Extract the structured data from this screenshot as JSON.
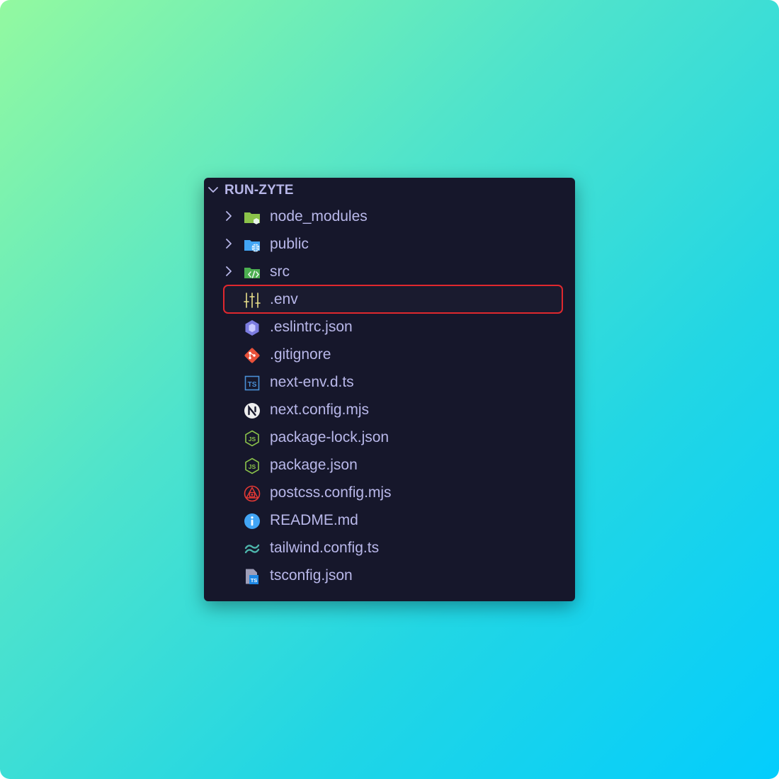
{
  "explorer": {
    "project_name": "RUN-ZYTE",
    "items": [
      {
        "label": "node_modules",
        "type": "folder",
        "icon": "folder-node-icon"
      },
      {
        "label": "public",
        "type": "folder",
        "icon": "folder-public-icon"
      },
      {
        "label": "src",
        "type": "folder",
        "icon": "folder-src-icon"
      },
      {
        "label": ".env",
        "type": "file",
        "icon": "env-settings-icon",
        "highlighted": true
      },
      {
        "label": ".eslintrc.json",
        "type": "file",
        "icon": "eslint-icon"
      },
      {
        "label": ".gitignore",
        "type": "file",
        "icon": "git-icon"
      },
      {
        "label": "next-env.d.ts",
        "type": "file",
        "icon": "typescript-def-icon"
      },
      {
        "label": "next.config.mjs",
        "type": "file",
        "icon": "nextjs-icon"
      },
      {
        "label": "package-lock.json",
        "type": "file",
        "icon": "nodejs-icon"
      },
      {
        "label": "package.json",
        "type": "file",
        "icon": "nodejs-icon"
      },
      {
        "label": "postcss.config.mjs",
        "type": "file",
        "icon": "postcss-icon"
      },
      {
        "label": "README.md",
        "type": "file",
        "icon": "info-icon"
      },
      {
        "label": "tailwind.config.ts",
        "type": "file",
        "icon": "tailwind-icon"
      },
      {
        "label": "tsconfig.json",
        "type": "file",
        "icon": "tsconfig-icon"
      }
    ]
  },
  "colors": {
    "panel_bg": "#16172b",
    "text": "#b9b8ea",
    "highlight_border": "#e0282e",
    "gradient_start": "#93f9a0",
    "gradient_end": "#03cdfd"
  }
}
